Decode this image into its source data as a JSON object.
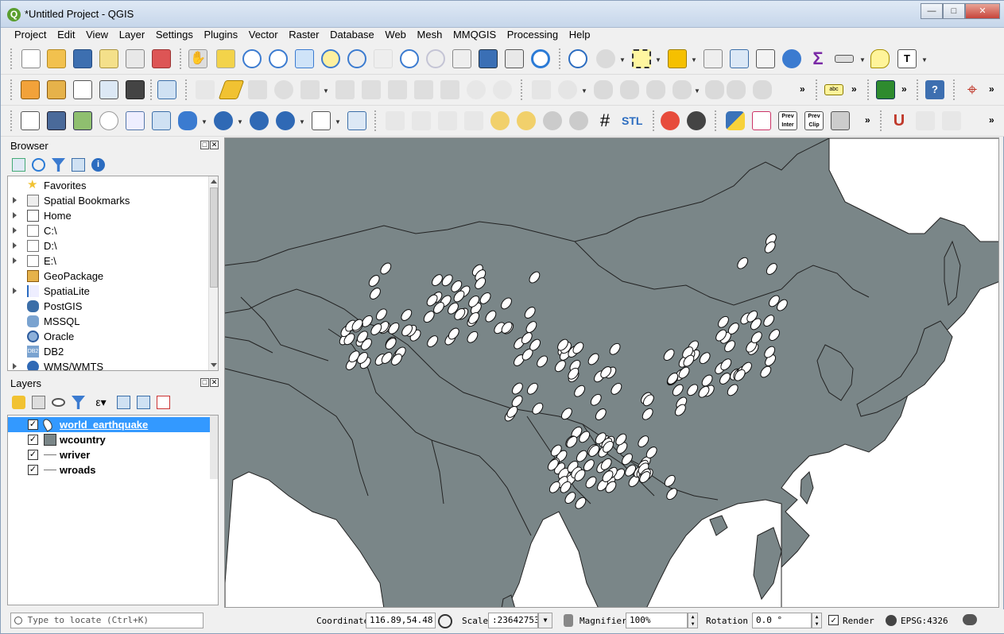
{
  "window": {
    "title": "*Untitled Project - QGIS",
    "logo": "Q"
  },
  "menu": [
    "Project",
    "Edit",
    "View",
    "Layer",
    "Settings",
    "Plugins",
    "Vector",
    "Raster",
    "Database",
    "Web",
    "Mesh",
    "MMQGIS",
    "Processing",
    "Help"
  ],
  "toolbar": {
    "overflow": "»",
    "stl": "STL",
    "prev_inter": "Prev Inter",
    "prev_clip": "Prev Clip",
    "abc": "abc"
  },
  "browser": {
    "title": "Browser",
    "items": [
      {
        "label": "Favorites",
        "icon": "star-icon",
        "expandable": false
      },
      {
        "label": "Spatial Bookmarks",
        "icon": "bookmark-icon",
        "expandable": true
      },
      {
        "label": "Home",
        "icon": "home-icon",
        "expandable": true
      },
      {
        "label": "C:\\",
        "icon": "folder-icon",
        "expandable": true
      },
      {
        "label": "D:\\",
        "icon": "folder-icon",
        "expandable": true
      },
      {
        "label": "E:\\",
        "icon": "folder-icon",
        "expandable": true
      },
      {
        "label": "GeoPackage",
        "icon": "geopackage-icon",
        "expandable": false
      },
      {
        "label": "SpatiaLite",
        "icon": "spatialite-icon",
        "expandable": true
      },
      {
        "label": "PostGIS",
        "icon": "postgis-icon",
        "expandable": false
      },
      {
        "label": "MSSQL",
        "icon": "mssql-icon",
        "expandable": false
      },
      {
        "label": "Oracle",
        "icon": "oracle-icon",
        "expandable": false
      },
      {
        "label": "DB2",
        "icon": "db2-icon",
        "expandable": false
      },
      {
        "label": "WMS/WMTS",
        "icon": "wms-icon",
        "expandable": true
      }
    ]
  },
  "layers_panel": {
    "title": "Layers",
    "layers": [
      {
        "name": "world_earthquake",
        "checked": true,
        "selected": true,
        "symbol": "point-symbol-icon"
      },
      {
        "name": "wcountry",
        "checked": true,
        "selected": false,
        "symbol": "polygon-symbol-icon"
      },
      {
        "name": "wriver",
        "checked": true,
        "selected": false,
        "symbol": "line-symbol-icon"
      },
      {
        "name": "wroads",
        "checked": true,
        "selected": false,
        "symbol": "line-symbol-icon"
      }
    ]
  },
  "statusbar": {
    "locate_placeholder": "Type to locate (Ctrl+K)",
    "coordinate_label": "Coordinate",
    "coordinate_value": "116.89,54.48",
    "scale_label": "Scale",
    "scale_value": ":23642753",
    "magnifier_label": "Magnifier",
    "magnifier_value": "100%",
    "rotation_label": "Rotation",
    "rotation_value": "0.0 °",
    "render_label": "Render",
    "render_checked": true,
    "crs": "EPSG:4326"
  },
  "colors": {
    "land": "#7a8688",
    "water": "#ffffff",
    "border": "#2a2a2a",
    "quake_fill": "#ffffff",
    "selection": "#3399ff"
  }
}
